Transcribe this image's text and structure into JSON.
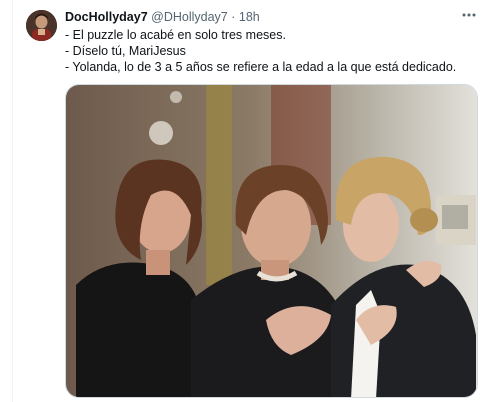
{
  "tweet": {
    "author_name": "DocHollyday7",
    "author_handle": "@DHollyday7",
    "separator": "·",
    "time": "18h",
    "text_lines": [
      "- El puzzle lo acabé en solo tres meses.",
      "- Díselo tú, MariJesus",
      "- Yolanda, lo de 3 a 5 años se refiere a la edad a la que está dedicado."
    ]
  },
  "icons": {
    "more": "more-horizontal-icon",
    "avatar": "user-avatar"
  },
  "colors": {
    "text_primary": "#0f1419",
    "text_secondary": "#536471",
    "border": "#cfd9de"
  }
}
